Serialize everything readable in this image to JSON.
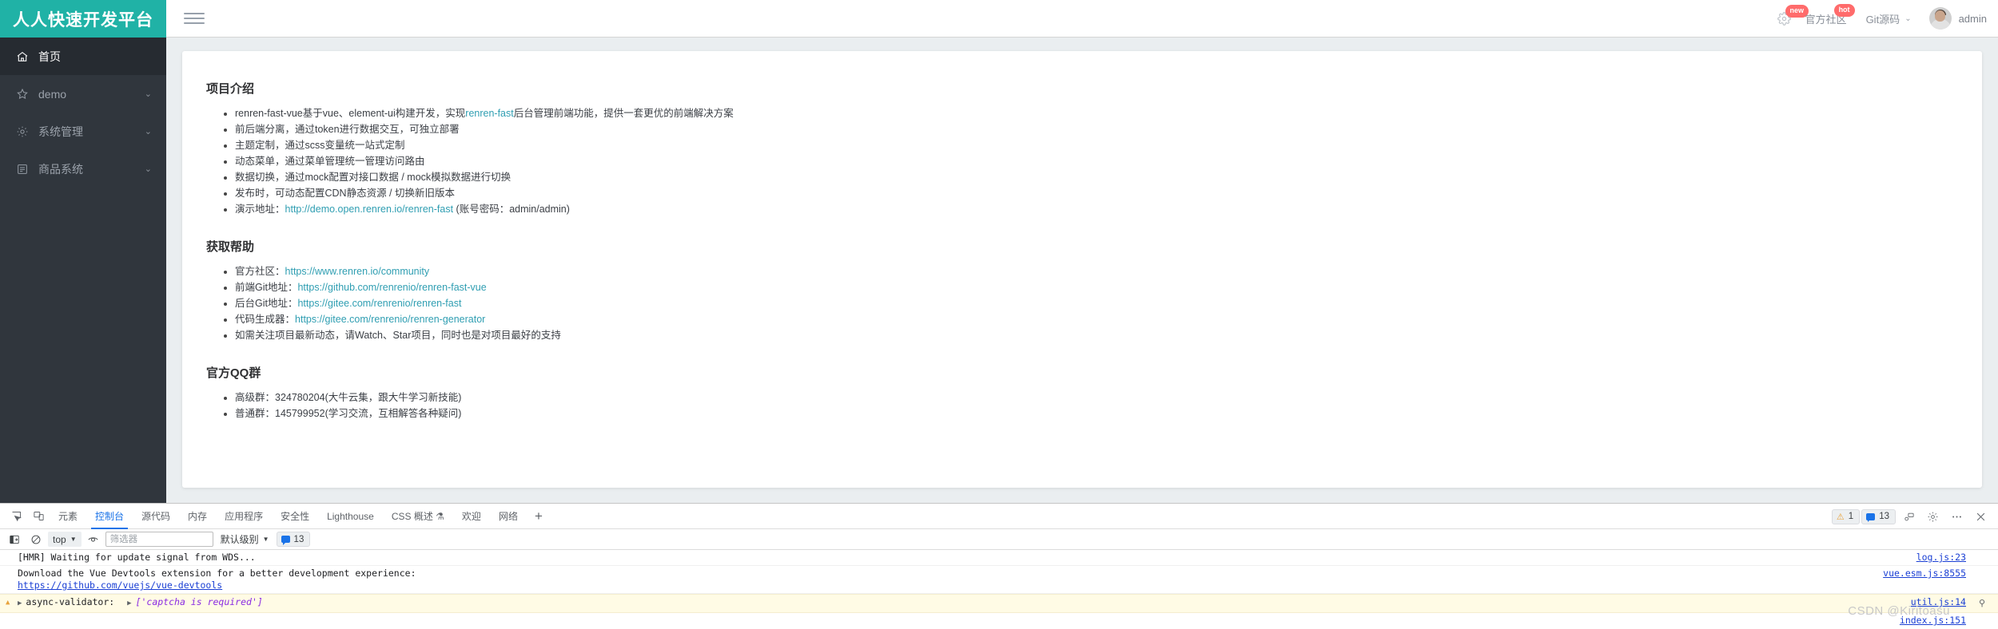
{
  "header": {
    "brand": "人人快速开发平台",
    "menu_toggle_icon": "hamburger-icon",
    "settings_icon": "gear-icon",
    "new_badge": "new",
    "hot_badge": "hot",
    "community_label": "官方社区",
    "git_label": "Git源码",
    "git_caret": "⌄",
    "user_name": "admin"
  },
  "sidebar": {
    "items": [
      {
        "label": "首页",
        "icon": "home-icon",
        "arrow": "",
        "active": true
      },
      {
        "label": "demo",
        "icon": "star-icon",
        "arrow": "⌄",
        "active": false
      },
      {
        "label": "系统管理",
        "icon": "gear-icon",
        "arrow": "⌄",
        "active": false
      },
      {
        "label": "商品系统",
        "icon": "document-icon",
        "arrow": "⌄",
        "active": false
      }
    ]
  },
  "content": {
    "sections": [
      {
        "title": "项目介绍",
        "items": [
          {
            "pre": "renren-fast-vue基于vue、element-ui构建开发，实现",
            "link": "renren-fast",
            "post": "后台管理前端功能，提供一套更优的前端解决方案"
          },
          {
            "pre": "前后端分离，通过token进行数据交互，可独立部署",
            "link": "",
            "post": ""
          },
          {
            "pre": "主题定制，通过scss变量统一站式定制",
            "link": "",
            "post": ""
          },
          {
            "pre": "动态菜单，通过菜单管理统一管理访问路由",
            "link": "",
            "post": ""
          },
          {
            "pre": "数据切换，通过mock配置对接口数据 / mock模拟数据进行切换",
            "link": "",
            "post": ""
          },
          {
            "pre": "发布时，可动态配置CDN静态资源 / 切换新旧版本",
            "link": "",
            "post": ""
          },
          {
            "pre": "演示地址：",
            "link": "http://demo.open.renren.io/renren-fast",
            "post": " (账号密码：admin/admin)"
          }
        ]
      },
      {
        "title": "获取帮助",
        "items": [
          {
            "pre": "官方社区：",
            "link": "https://www.renren.io/community",
            "post": ""
          },
          {
            "pre": "前端Git地址：",
            "link": "https://github.com/renrenio/renren-fast-vue",
            "post": ""
          },
          {
            "pre": "后台Git地址：",
            "link": "https://gitee.com/renrenio/renren-fast",
            "post": ""
          },
          {
            "pre": "代码生成器：",
            "link": "https://gitee.com/renrenio/renren-generator",
            "post": ""
          },
          {
            "pre": "如需关注项目最新动态，请Watch、Star项目，同时也是对项目最好的支持",
            "link": "",
            "post": ""
          }
        ]
      },
      {
        "title": "官方QQ群",
        "items": [
          {
            "pre": "高级群：324780204(大牛云集，跟大牛学习新技能)",
            "link": "",
            "post": ""
          },
          {
            "pre": "普通群：145799952(学习交流，互相解答各种疑问)",
            "link": "",
            "post": ""
          }
        ]
      }
    ]
  },
  "devtools": {
    "left_icons": [
      "inspect-element-icon",
      "device-toolbar-icon"
    ],
    "tabs": [
      {
        "label": "元素",
        "selected": false
      },
      {
        "label": "控制台",
        "selected": true
      },
      {
        "label": "源代码",
        "selected": false
      },
      {
        "label": "内存",
        "selected": false
      },
      {
        "label": "应用程序",
        "selected": false
      },
      {
        "label": "安全性",
        "selected": false
      },
      {
        "label": "Lighthouse",
        "selected": false
      },
      {
        "label": "CSS 概述 ⚗",
        "selected": false
      },
      {
        "label": "欢迎",
        "selected": false
      },
      {
        "label": "网络",
        "selected": false
      }
    ],
    "add_tab": "+",
    "warning_count": "1",
    "message_count": "13",
    "right_icons": [
      "devices-icon",
      "settings-gear-icon",
      "more-options-icon",
      "close-icon"
    ],
    "toolbar": {
      "sidebar_toggle_icon": "console-sidebar-icon",
      "clear_icon": "clear-console-icon",
      "context": "top",
      "context_caret": "▼",
      "eye_icon": "live-expression-icon",
      "filter_placeholder": "筛选器",
      "filter_value": "",
      "level": "默认级别",
      "level_caret": "▼",
      "badge_count": "13"
    },
    "console_rows": [
      {
        "type": "log",
        "text": "[HMR] Waiting for update signal from WDS...",
        "link": "",
        "source": "log.js:23"
      },
      {
        "type": "log",
        "text": "Download the Vue Devtools extension for a better development experience:",
        "link": "https://github.com/vuejs/vue-devtools",
        "source": "vue.esm.js:8555"
      },
      {
        "type": "warning",
        "label": "async-validator:",
        "array_value": "['captcha is required']",
        "source": "util.js:14",
        "source2": "index.js:151"
      }
    ],
    "watermark": "CSDN @Kiritoasu"
  },
  "colors": {
    "brand_teal": "#20b2a6",
    "sidebar_dark": "#30363d",
    "link_teal": "#2f9eb2",
    "devtools_blue": "#1a73e8"
  }
}
